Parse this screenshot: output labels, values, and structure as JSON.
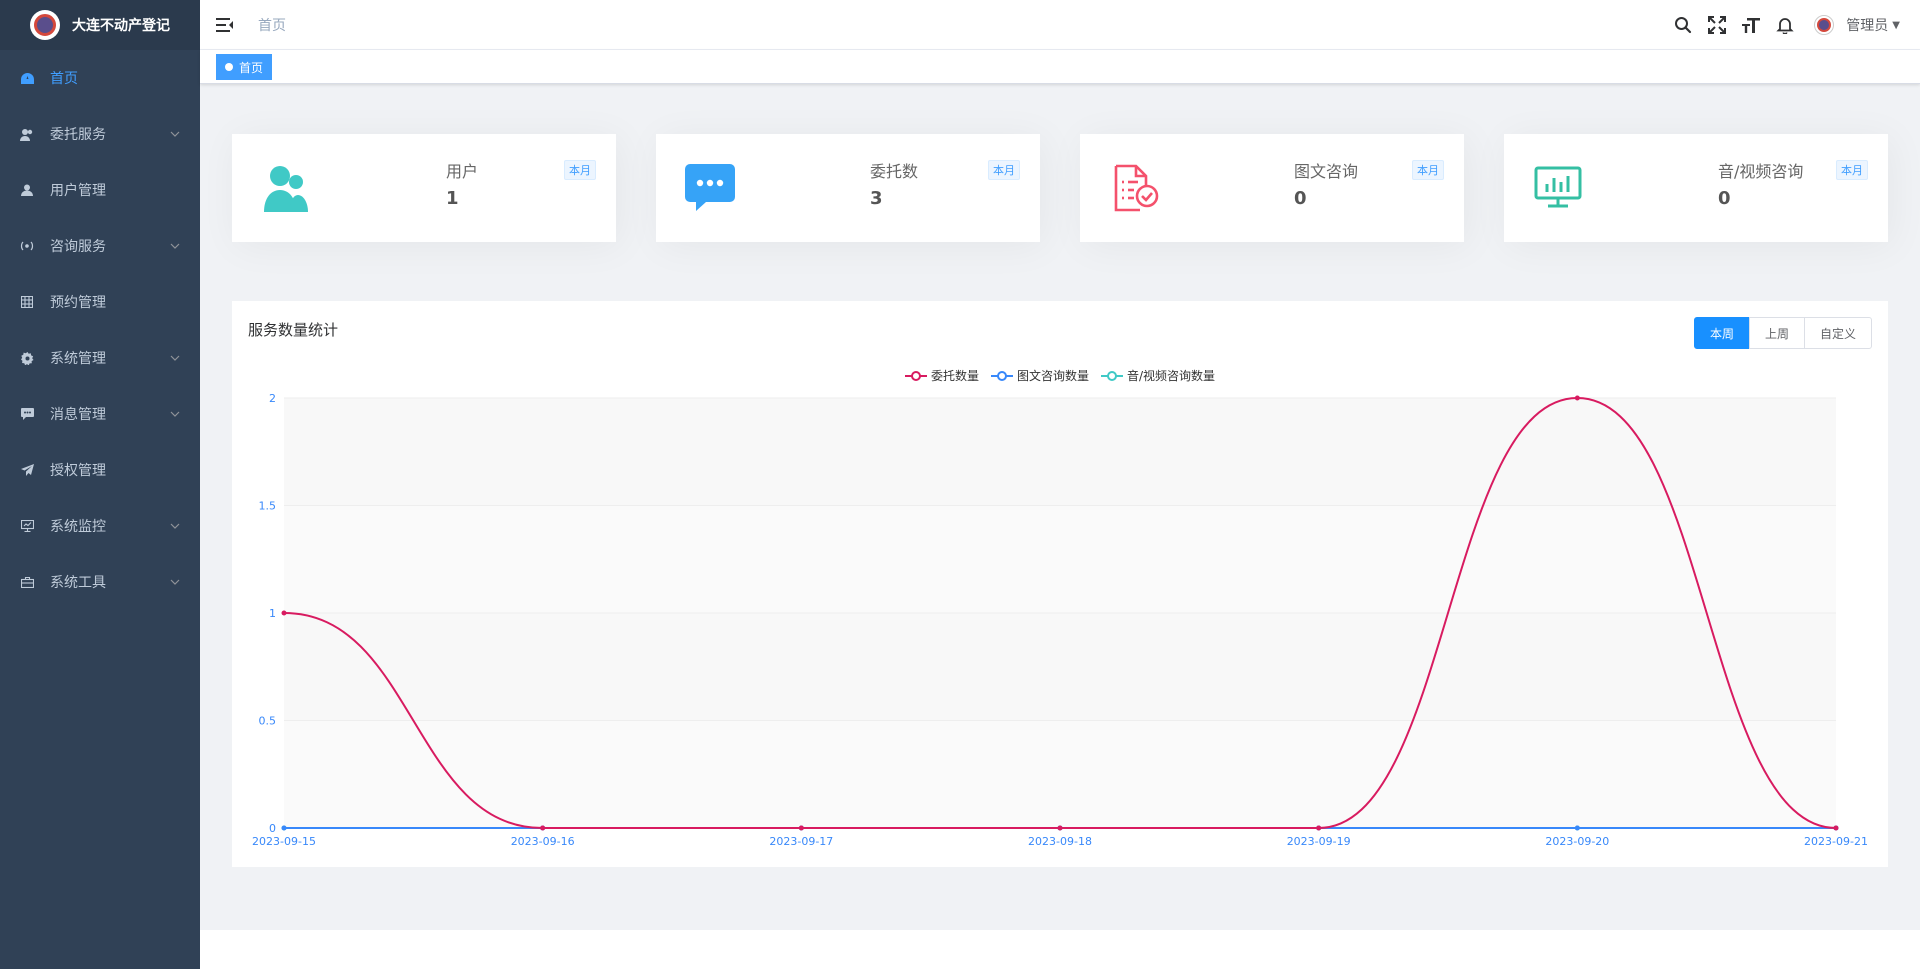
{
  "app": {
    "title": "大连不动产登记"
  },
  "sidebar": {
    "items": [
      {
        "label": "首页",
        "icon": "dashboard-icon",
        "active": true,
        "has_children": false
      },
      {
        "label": "委托服务",
        "icon": "user-group-icon",
        "has_children": true
      },
      {
        "label": "用户管理",
        "icon": "user-icon",
        "has_children": false
      },
      {
        "label": "咨询服务",
        "icon": "chat-icon",
        "has_children": true
      },
      {
        "label": "预约管理",
        "icon": "grid-icon",
        "has_children": false
      },
      {
        "label": "系统管理",
        "icon": "gear-icon",
        "has_children": true
      },
      {
        "label": "消息管理",
        "icon": "message-icon",
        "has_children": true
      },
      {
        "label": "授权管理",
        "icon": "paper-plane-icon",
        "has_children": false
      },
      {
        "label": "系统监控",
        "icon": "monitor-icon",
        "has_children": true
      },
      {
        "label": "系统工具",
        "icon": "toolbox-icon",
        "has_children": true
      }
    ]
  },
  "header": {
    "breadcrumb": "首页",
    "username": "管理员"
  },
  "tags": {
    "active_tag": "首页"
  },
  "stats": [
    {
      "title": "用户",
      "badge": "本月",
      "value": "1",
      "icon": "users-icon",
      "color": "#40c9c6"
    },
    {
      "title": "委托数",
      "badge": "本月",
      "value": "3",
      "icon": "message-bubble-icon",
      "color": "#36a3f7"
    },
    {
      "title": "图文咨询",
      "badge": "本月",
      "value": "0",
      "icon": "document-check-icon",
      "color": "#f4516c"
    },
    {
      "title": "音/视频咨询",
      "badge": "本月",
      "value": "0",
      "icon": "monitor-chart-icon",
      "color": "#34bfa3"
    }
  ],
  "chart_panel": {
    "title": "服务数量统计",
    "buttons": [
      "本周",
      "上周",
      "自定义"
    ],
    "active_button": "本周"
  },
  "chart_data": {
    "type": "line",
    "x": [
      "2023-09-15",
      "2023-09-16",
      "2023-09-17",
      "2023-09-18",
      "2023-09-19",
      "2023-09-20",
      "2023-09-21"
    ],
    "series": [
      {
        "name": "委托数量",
        "values": [
          1,
          0,
          0,
          0,
          0,
          2,
          0
        ],
        "color": "#d81b60"
      },
      {
        "name": "图文咨询数量",
        "values": [
          0,
          0,
          0,
          0,
          0,
          0,
          0
        ],
        "color": "#3888fa"
      },
      {
        "name": "音/视频咨询数量",
        "values": [
          0,
          0,
          0,
          0,
          0,
          0,
          0
        ],
        "color": "#40c9c6"
      }
    ],
    "y_ticks": [
      "0",
      "0.5",
      "1",
      "1.5",
      "2"
    ],
    "ylim": [
      0,
      2
    ],
    "smooth": true,
    "legend": "top-center"
  }
}
